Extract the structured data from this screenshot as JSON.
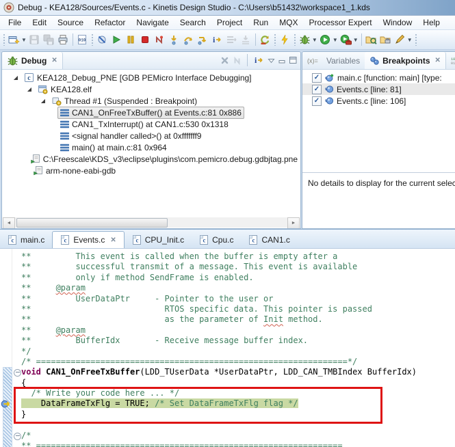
{
  "window": {
    "title": "Debug - KEA128/Sources/Events.c - Kinetis Design Studio - C:\\Users\\b51432\\workspace1_1.kds"
  },
  "menu": {
    "items": [
      "File",
      "Edit",
      "Source",
      "Refactor",
      "Navigate",
      "Search",
      "Project",
      "Run",
      "MQX",
      "Processor Expert",
      "Window",
      "Help"
    ]
  },
  "toolbar": {
    "items": [
      {
        "type": "handle"
      },
      {
        "type": "btn",
        "name": "new-button",
        "icon": "new-wizard",
        "dropdown": true
      },
      {
        "type": "btn",
        "name": "save-button",
        "icon": "save",
        "disabled": true
      },
      {
        "type": "btn",
        "name": "save-all-button",
        "icon": "save-all",
        "disabled": true
      },
      {
        "type": "btn",
        "name": "print-button",
        "icon": "print"
      },
      {
        "type": "sep"
      },
      {
        "type": "btn",
        "name": "binary-file-button",
        "icon": "binary"
      },
      {
        "type": "handle"
      },
      {
        "type": "btn",
        "name": "skip-all-breakpoints-button",
        "icon": "skip-bp"
      },
      {
        "type": "btn",
        "name": "resume-button",
        "icon": "resume"
      },
      {
        "type": "btn",
        "name": "suspend-button",
        "icon": "suspend"
      },
      {
        "type": "btn",
        "name": "terminate-button",
        "icon": "terminate"
      },
      {
        "type": "btn",
        "name": "disconnect-button",
        "icon": "disconnect"
      },
      {
        "type": "btn",
        "name": "step-into-button",
        "icon": "step-into"
      },
      {
        "type": "btn",
        "name": "step-over-button",
        "icon": "step-over"
      },
      {
        "type": "btn",
        "name": "step-return-button",
        "icon": "step-return"
      },
      {
        "type": "btn",
        "name": "instruction-stepping-button",
        "icon": "instr-step"
      },
      {
        "type": "btn",
        "name": "show-next-statement-button",
        "icon": "show-next",
        "disabled": true
      },
      {
        "type": "btn",
        "name": "drop-to-frame-button",
        "icon": "drop-frame",
        "disabled": true
      },
      {
        "type": "sep"
      },
      {
        "type": "btn",
        "name": "refresh-button",
        "icon": "refresh-pe"
      },
      {
        "type": "handle"
      },
      {
        "type": "btn",
        "name": "generate-code-button",
        "icon": "flash"
      },
      {
        "type": "handle"
      },
      {
        "type": "btn",
        "name": "debug-button",
        "icon": "debug-bug",
        "dropdown": true
      },
      {
        "type": "btn",
        "name": "run-button",
        "icon": "run",
        "dropdown": true
      },
      {
        "type": "btn",
        "name": "external-tools-button",
        "icon": "ext-tools",
        "dropdown": true
      },
      {
        "type": "sep"
      },
      {
        "type": "btn",
        "name": "open-element-button",
        "icon": "open-element"
      },
      {
        "type": "btn",
        "name": "open-resource-button",
        "icon": "folder-case"
      },
      {
        "type": "btn",
        "name": "mark-occurrences-button",
        "icon": "pen",
        "dropdown": true
      },
      {
        "type": "handle"
      }
    ]
  },
  "debug_panel": {
    "title": "Debug",
    "tree": [
      {
        "indent": 0,
        "icon": "c-launch",
        "label": "KEA128_Debug_PNE [GDB PEMicro Interface Debugging]",
        "expanded": true
      },
      {
        "indent": 1,
        "icon": "elf",
        "label": "KEA128.elf",
        "expanded": true
      },
      {
        "indent": 2,
        "icon": "thread",
        "label": "Thread #1 (Suspended : Breakpoint)",
        "expanded": true
      },
      {
        "indent": 3,
        "icon": "stack-frame",
        "label": "CAN1_OnFreeTxBuffer() at Events.c:81 0x886",
        "selected": true
      },
      {
        "indent": 3,
        "icon": "stack-frame",
        "label": "CAN1_TxInterrupt() at CAN1.c:530 0x1318"
      },
      {
        "indent": 3,
        "icon": "stack-frame",
        "label": "<signal handler called>() at 0xfffffff9"
      },
      {
        "indent": 3,
        "icon": "stack-frame",
        "label": "main() at main.c:81 0x964"
      },
      {
        "indent": 1,
        "icon": "process",
        "label": "C:\\Freescale\\KDS_v3\\eclipse\\plugins\\com.pemicro.debug.gdbjtag.pne"
      },
      {
        "indent": 1,
        "icon": "process",
        "label": "arm-none-eabi-gdb"
      }
    ]
  },
  "right_panel": {
    "tabs": [
      {
        "label": "Variables",
        "icon": "variables",
        "state": "inactive"
      },
      {
        "label": "Breakpoints",
        "icon": "breakpoints",
        "state": "active",
        "closable": true
      },
      {
        "label": "R",
        "icon": "registers",
        "state": "inactive"
      }
    ],
    "breakpoints": [
      {
        "checked": true,
        "icon": "function-breakpoint",
        "label": "main.c [function: main] [type:"
      },
      {
        "checked": true,
        "icon": "line-breakpoint",
        "label": "Events.c [line: 81]",
        "selected": true
      },
      {
        "checked": true,
        "icon": "line-breakpoint",
        "label": "Events.c [line: 106]"
      }
    ],
    "details_message": "No details to display for the current selection."
  },
  "editor": {
    "tabs": [
      {
        "label": "main.c",
        "icon": "c-file"
      },
      {
        "label": "Events.c",
        "icon": "c-file",
        "active": true,
        "closable": true
      },
      {
        "label": "CPU_Init.c",
        "icon": "c-file"
      },
      {
        "label": "Cpu.c",
        "icon": "c-file"
      },
      {
        "label": "CAN1.c",
        "icon": "c-file"
      }
    ],
    "code": {
      "lines": [
        {
          "segs": [
            [
              "c",
              "**         This event is called when the buffer is empty after a"
            ]
          ]
        },
        {
          "segs": [
            [
              "c",
              "**         successful transmit of a message. This event is available"
            ]
          ]
        },
        {
          "segs": [
            [
              "c",
              "**         only if method SendFrame is enabled."
            ]
          ]
        },
        {
          "segs": [
            [
              "c",
              "**     "
            ],
            [
              "cu",
              "@param"
            ]
          ]
        },
        {
          "segs": [
            [
              "c",
              "**         UserDataPtr     - Pointer to the user or"
            ]
          ]
        },
        {
          "segs": [
            [
              "c",
              "**                           RTOS specific data. This pointer is passed"
            ]
          ]
        },
        {
          "segs": [
            [
              "c",
              "**                           as the parameter of "
            ],
            [
              "cu",
              "Init"
            ],
            [
              "c",
              " method."
            ]
          ]
        },
        {
          "segs": [
            [
              "c",
              "**     "
            ],
            [
              "cu",
              "@param"
            ]
          ]
        },
        {
          "segs": [
            [
              "c",
              "**         BufferIdx       - Receive message buffer index."
            ]
          ]
        },
        {
          "segs": [
            [
              "c",
              "*/"
            ]
          ]
        },
        {
          "segs": [
            [
              "c",
              "/* ===============================================================*/"
            ]
          ]
        },
        {
          "fold": true,
          "segs": [
            [
              "k",
              "void"
            ],
            [
              "p",
              " "
            ],
            [
              "fn",
              "CAN1_OnFreeTxBuffer"
            ],
            [
              "p",
              "(LDD_TUserData *UserDataPtr, LDD_CAN_TMBIndex BufferIdx)"
            ]
          ]
        },
        {
          "segs": [
            [
              "p",
              "{"
            ]
          ]
        },
        {
          "segs": [
            [
              "c",
              "  /* Write your code here ... */"
            ]
          ]
        },
        {
          "hl": true,
          "bp": true,
          "segs": [
            [
              "p",
              "    DataFrameTxFlg = TRUE; "
            ],
            [
              "c",
              "/* Set DataFrameTxFlg flag */"
            ]
          ]
        },
        {
          "segs": [
            [
              "p",
              "}"
            ]
          ]
        },
        {
          "segs": []
        },
        {
          "fold": true,
          "segs": [
            [
              "c",
              "/*"
            ]
          ]
        },
        {
          "segs": [
            [
              "c",
              "** =============================================================="
            ]
          ]
        }
      ]
    }
  },
  "colors": {
    "comment": "#3f7f5f",
    "keyword": "#7f0055",
    "ip_highlight": "#c9d9a3",
    "annotation_box": "#de1414",
    "selection_bg": "#e8e8e8"
  }
}
